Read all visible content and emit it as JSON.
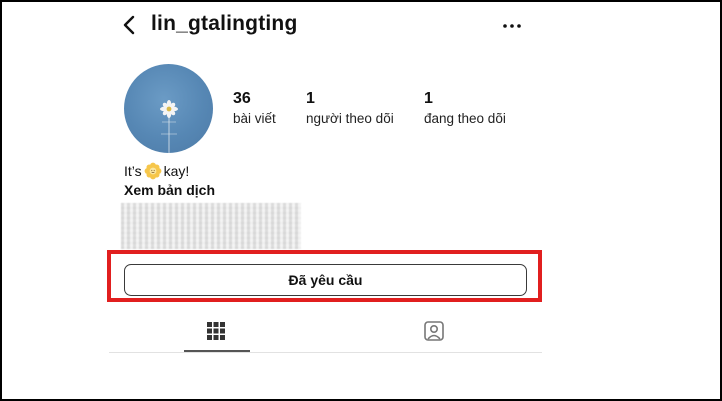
{
  "header": {
    "username": "lin_gtalingting"
  },
  "stats": [
    {
      "value": "36",
      "label": "bài viết"
    },
    {
      "value": "1",
      "label": "người theo dõi"
    },
    {
      "value": "1",
      "label": "đang theo dõi"
    }
  ],
  "bio": {
    "text_before": "It’s ",
    "text_after": "kay!",
    "translate_label": "Xem bản dịch"
  },
  "actions": {
    "request_label": "Đã yêu cầu"
  },
  "tabs": {
    "active": "posts-grid"
  },
  "colors": {
    "highlight": "#e11f1f",
    "avatar_bg": "#5687b4"
  },
  "icons": [
    "back-arrow-icon",
    "more-options-icon",
    "flower-emoji-icon",
    "grid-icon",
    "tagged-icon"
  ]
}
